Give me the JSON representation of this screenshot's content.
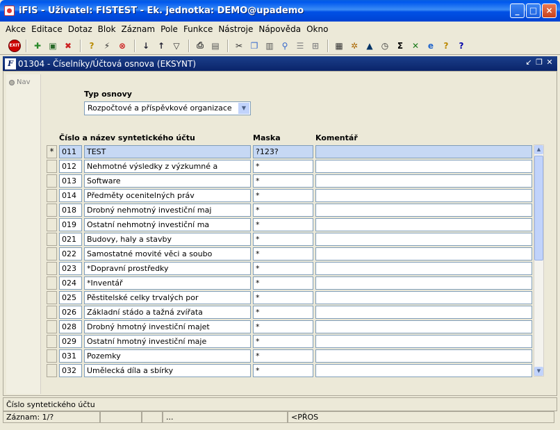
{
  "window": {
    "title": "iFIS - Uživatel: FISTEST - Ek. jednotka: DEMO@upademo",
    "minimize": "_",
    "maximize": "□",
    "close": "×"
  },
  "menu": [
    "Akce",
    "Editace",
    "Dotaz",
    "Blok",
    "Záznam",
    "Pole",
    "Funkce",
    "Nástroje",
    "Nápověda",
    "Okno"
  ],
  "toolbar": {
    "exit_label": "EXIT",
    "icons": [
      "exit-icon",
      "new-record-icon",
      "save-icon",
      "delete-record-icon",
      "enter-query-icon",
      "execute-query-icon",
      "cancel-query-icon",
      "sort-asc-icon",
      "sort-desc-icon",
      "filter-icon",
      "print-icon",
      "print-preview-icon",
      "cut-icon",
      "copy-icon",
      "paste-icon",
      "search-icon",
      "list-icon",
      "tree-icon",
      "calculator-icon",
      "settings-icon",
      "triangle-icon",
      "clock-icon",
      "sum-icon",
      "excel-icon",
      "internet-icon",
      "help-icon",
      "context-help-icon"
    ]
  },
  "form": {
    "icon_label": "F",
    "caption": "01304 - Číselníky/Účtová osnova (EKSYNT)",
    "nav_label": "Nav",
    "type_label": "Typ osnovy",
    "type_value": "Rozpočtové a příspěvkové organizace",
    "col_number_name": "Číslo a název syntetického účtu",
    "col_mask": "Maska",
    "col_comment": "Komentář",
    "rows": [
      {
        "marker": "*",
        "num": "011",
        "name": "TEST",
        "mask": "?123?",
        "comment": ""
      },
      {
        "marker": "",
        "num": "012",
        "name": "Nehmotné výsledky z výzkumné a",
        "mask": "*",
        "comment": ""
      },
      {
        "marker": "",
        "num": "013",
        "name": "Software",
        "mask": "*",
        "comment": ""
      },
      {
        "marker": "",
        "num": "014",
        "name": "Předměty ocenitelných práv",
        "mask": "*",
        "comment": ""
      },
      {
        "marker": "",
        "num": "018",
        "name": "Drobný nehmotný investiční maj",
        "mask": "*",
        "comment": ""
      },
      {
        "marker": "",
        "num": "019",
        "name": "Ostatní nehmotný investiční ma",
        "mask": "*",
        "comment": ""
      },
      {
        "marker": "",
        "num": "021",
        "name": "Budovy, haly a stavby",
        "mask": "*",
        "comment": ""
      },
      {
        "marker": "",
        "num": "022",
        "name": "Samostatné movité věci a soubo",
        "mask": "*",
        "comment": ""
      },
      {
        "marker": "",
        "num": "023",
        "name": "*Dopravní prostředky",
        "mask": "*",
        "comment": ""
      },
      {
        "marker": "",
        "num": "024",
        "name": "*Inventář",
        "mask": "*",
        "comment": ""
      },
      {
        "marker": "",
        "num": "025",
        "name": "Pěstitelské celky trvalých por",
        "mask": "*",
        "comment": ""
      },
      {
        "marker": "",
        "num": "026",
        "name": "Základní stádo a tažná zvířata",
        "mask": "*",
        "comment": ""
      },
      {
        "marker": "",
        "num": "028",
        "name": "Drobný hmotný investiční majet",
        "mask": "*",
        "comment": ""
      },
      {
        "marker": "",
        "num": "029",
        "name": "Ostatní hmotný investiční maje",
        "mask": "*",
        "comment": ""
      },
      {
        "marker": "",
        "num": "031",
        "name": "Pozemky",
        "mask": "*",
        "comment": ""
      },
      {
        "marker": "",
        "num": "032",
        "name": "Umělecká díla a sbírky",
        "mask": "*",
        "comment": ""
      }
    ]
  },
  "status": {
    "hint": "Číslo syntetického účtu",
    "record": "Záznam: 1/?",
    "dots": "...",
    "mode": "<PŘOS"
  }
}
